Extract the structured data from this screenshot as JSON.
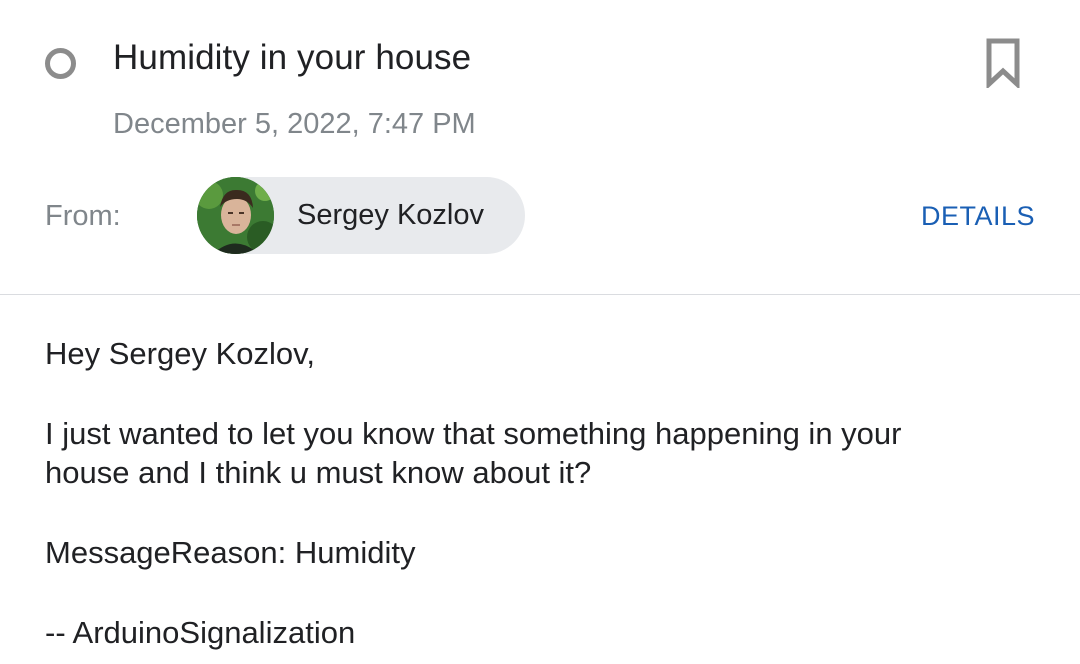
{
  "message": {
    "subject": "Humidity in your house",
    "date": "December 5, 2022, 7:47 PM",
    "from_label": "From:",
    "sender_name": "Sergey Kozlov",
    "details_label": "DETAILS"
  },
  "body": {
    "greeting": "Hey Sergey Kozlov,",
    "line1": "I just wanted to let you know that something happening in your",
    "line2": "house and I think u must know about it?",
    "reason": "MessageReason: Humidity",
    "signature": "-- ArduinoSignalization"
  },
  "icons": {
    "status": "circle-outline-icon",
    "bookmark": "bookmark-icon"
  },
  "colors": {
    "accent": "#1a5fb4",
    "secondary_text": "#80868b",
    "chip_bg": "#e8eaed"
  }
}
